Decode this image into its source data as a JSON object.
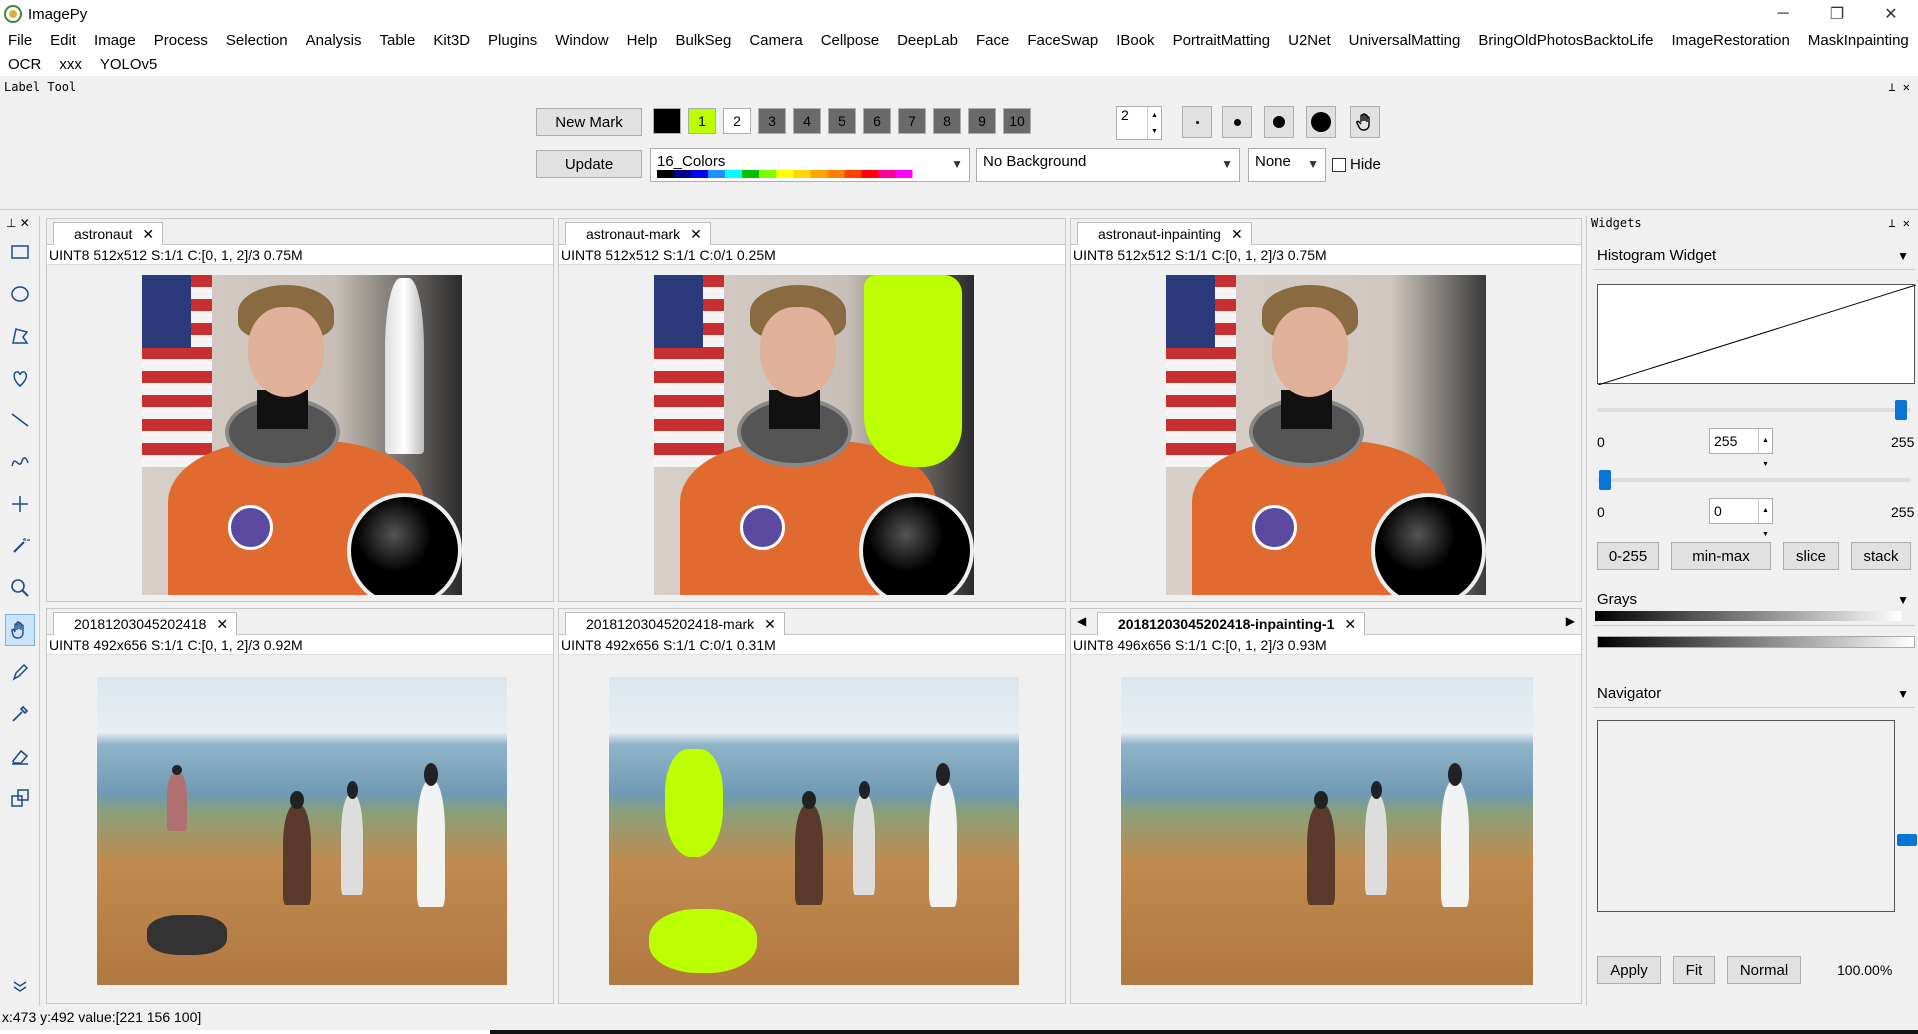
{
  "window": {
    "title": "ImagePy",
    "minimize": "─",
    "restore": "❐",
    "close": "✕"
  },
  "menubar": {
    "row1": [
      "File",
      "Edit",
      "Image",
      "Process",
      "Selection",
      "Analysis",
      "Table",
      "Kit3D",
      "Plugins",
      "Window",
      "Help",
      "BulkSeg",
      "Camera",
      "Cellpose",
      "DeepLab",
      "Face",
      "FaceSwap",
      "IBook",
      "PortraitMatting",
      "U2Net",
      "UniversalMatting",
      "BringOldPhotosBacktoLife",
      "ImageRestoration",
      "MaskInpainting"
    ],
    "row2": [
      "OCR",
      "xxx",
      "YOLOv5"
    ]
  },
  "label_tool": {
    "title": "Label Tool",
    "new_mark": "New Mark",
    "update": "Update",
    "swatches": [
      "1",
      "2",
      "3",
      "4",
      "5",
      "6",
      "7",
      "8",
      "9",
      "10"
    ],
    "swatch_colors": [
      "#000000",
      "#bbff00",
      "#ffffff",
      "#555555",
      "#555555",
      "#555555",
      "#555555",
      "#555555",
      "#555555",
      "#555555",
      "#555555"
    ],
    "pen_size": "2",
    "palette": "16_Colors",
    "background": "No Background",
    "mode": "None",
    "hide": "Hide"
  },
  "left_tools": {
    "pin": "⊥ ✕"
  },
  "panels": [
    {
      "tab": "astronaut",
      "info": "UINT8  512x512  S:1/1  C:[0, 1, 2]/3  0.75M"
    },
    {
      "tab": "astronaut-mark",
      "info": "UINT8  512x512  S:1/1  C:0/1  0.25M"
    },
    {
      "tab": "astronaut-inpainting",
      "info": "UINT8  512x512  S:1/1  C:[0, 1, 2]/3  0.75M"
    },
    {
      "tab": "20181203045202418",
      "info": "UINT8  492x656  S:1/1  C:[0, 1, 2]/3  0.92M"
    },
    {
      "tab": "20181203045202418-mark",
      "info": "UINT8  492x656  S:1/1  C:0/1  0.31M"
    },
    {
      "tab": "20181203045202418-inpainting-1",
      "info": "UINT8  496x656  S:1/1  C:[0, 1, 2]/3  0.93M"
    }
  ],
  "widgets": {
    "title": "Widgets",
    "histogram_combo": "Histogram Widget",
    "max_low": "0",
    "max_value": "255",
    "max_high": "255",
    "min_low": "0",
    "min_value": "0",
    "min_high": "255",
    "buttons": [
      "0-255",
      "min-max",
      "slice",
      "stack"
    ],
    "lut": "Grays",
    "navigator": "Navigator",
    "nav_buttons": [
      "Apply",
      "Fit",
      "Normal"
    ],
    "zoom": "100.00%"
  },
  "status": "x:473 y:492  value:[221 156 100]"
}
